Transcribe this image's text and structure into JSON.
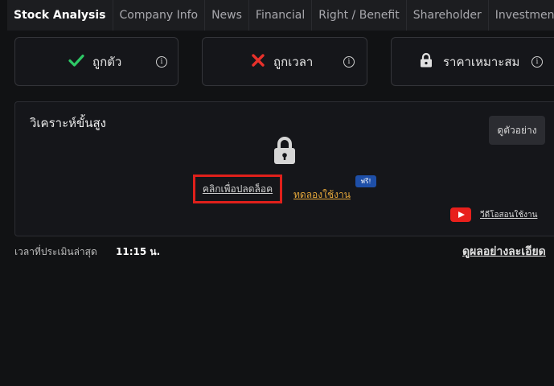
{
  "tabs": [
    {
      "label": "Stock Analysis",
      "active": true
    },
    {
      "label": "Company Info",
      "active": false
    },
    {
      "label": "News",
      "active": false
    },
    {
      "label": "Financial",
      "active": false
    },
    {
      "label": "Right / Benefit",
      "active": false
    },
    {
      "label": "Shareholder",
      "active": false
    },
    {
      "label": "Investment",
      "active": false
    }
  ],
  "cards": [
    {
      "label": "ถูกตัว",
      "icon": "check-icon",
      "icon_color": "#2ec866",
      "info": "i"
    },
    {
      "label": "ถูกเวลา",
      "icon": "close-icon",
      "icon_color": "#e8312b",
      "info": "i"
    },
    {
      "label": "ราคาเหมาะสม",
      "icon": "lock-icon",
      "icon_color": "#e0e0e0",
      "info": "i"
    }
  ],
  "advanced": {
    "title": "วิเคราะห์ขั้นสูง",
    "example_button": "ดูตัวอย่าง",
    "unlock_link": "คลิกเพื่อปลดล็อค",
    "trial_link": "ทดลองใช้งาน",
    "free_badge": "ฟรี!",
    "tutorial_link": "วีดีโอสอนใช้งาน"
  },
  "footer": {
    "last_eval_label": "เวลาที่ประเมินล่าสุด",
    "last_eval_time": "11:15 น.",
    "details_link": "ดูผลอย่างละเอียด"
  },
  "colors": {
    "accent_red": "#e0201b",
    "trial_orange": "#e3a63a",
    "badge_blue": "#1e4fa8",
    "youtube_red": "#e8201c"
  }
}
